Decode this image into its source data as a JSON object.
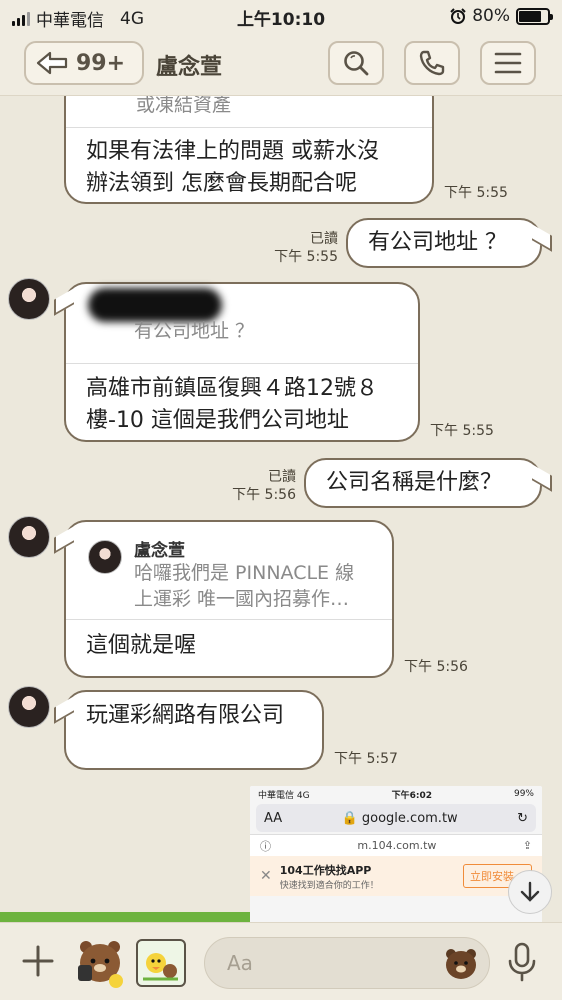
{
  "status_bar": {
    "carrier": "中華電信",
    "network": "4G",
    "time": "上午10:10",
    "battery": "80%",
    "battery_level": 0.8
  },
  "header": {
    "back_count": "99+",
    "title": "盧念萱"
  },
  "messages": {
    "m1": {
      "quote_partial": "或凍結資產",
      "text": "如果有法律上的問題  或薪水沒\n辦法領到  怎麼會長期配合呢",
      "time": "下午 5:55"
    },
    "m2": {
      "text": "有公司地址 ？",
      "read": "已讀",
      "time": "下午 5:55"
    },
    "m3": {
      "quote_text": "有公司地址 ？",
      "text": "高雄市前鎮區復興４路12號８\n樓-10  這個是我們公司地址",
      "time": "下午 5:55"
    },
    "m4": {
      "text": "公司名稱是什麼？",
      "read": "已讀",
      "time": "下午 5:56"
    },
    "m5": {
      "quote_name": "盧念萱",
      "quote_text": "哈囉我們是 PINNACLE 線\n上運彩 唯一國內招募作…",
      "text": "這個就是喔",
      "time": "下午 5:56"
    },
    "m6": {
      "text": "玩運彩網路有限公司",
      "time": "下午 5:57"
    }
  },
  "screenshot_preview": {
    "carrier": "中華電信",
    "network": "4G",
    "time": "下午6:02",
    "battery": "99%",
    "aa": "AA",
    "url": "google.com.tw",
    "sub_url": "m.104.com.tw",
    "app_title": "104工作快找APP",
    "app_sub": "快速找到適合你的工作！",
    "install": "立即安裝 A"
  },
  "input": {
    "placeholder": "Aa"
  },
  "colors": {
    "background": "#ece8dc",
    "bubble_border": "#7c6e5b",
    "header": "#f0ece1"
  }
}
